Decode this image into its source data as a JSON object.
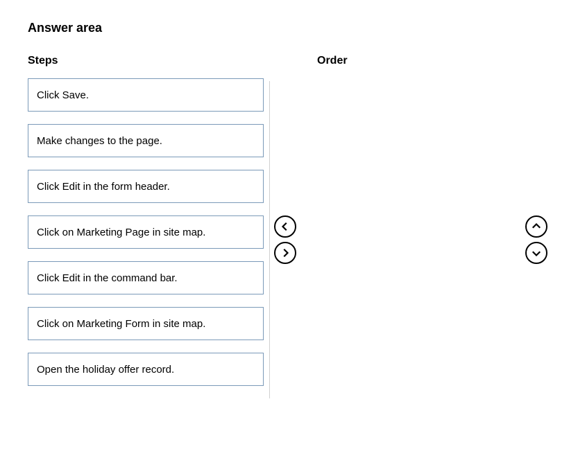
{
  "title": "Answer area",
  "stepsHeader": "Steps",
  "orderHeader": "Order",
  "steps": [
    "Click Save.",
    "Make changes to the page.",
    "Click Edit in the form header.",
    "Click on Marketing Page in site map.",
    "Click Edit in the command bar.",
    "Click on Marketing Form in site map.",
    "Open the holiday offer record."
  ]
}
